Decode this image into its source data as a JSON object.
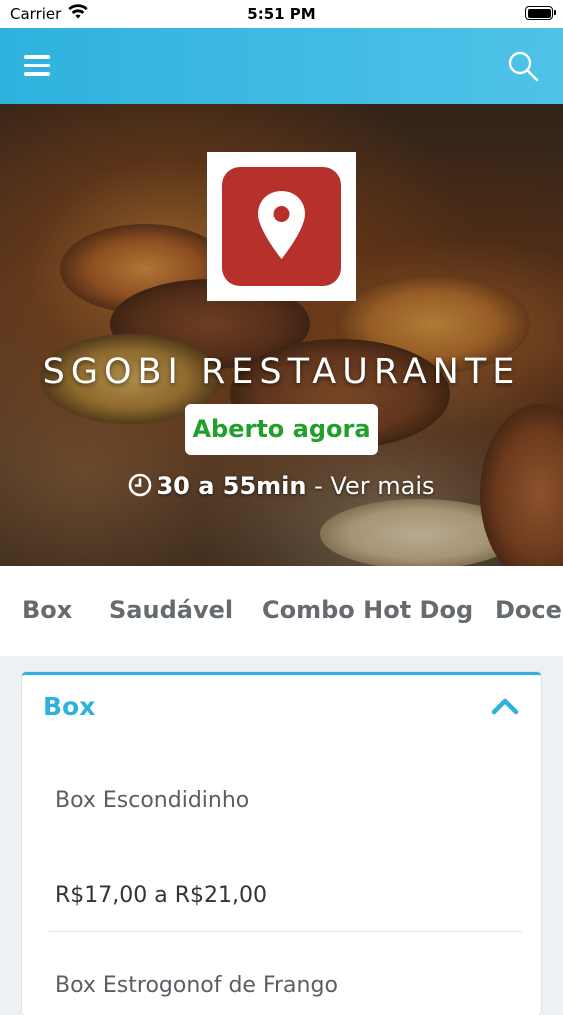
{
  "status_bar": {
    "carrier": "Carrier",
    "time": "5:51 PM"
  },
  "app_bar": {
    "menu_icon": "hamburger-menu-icon",
    "search_icon": "search-icon",
    "color": "#2eb2dd"
  },
  "restaurant": {
    "name": "SGOBI RESTAURANTE",
    "status": "Aberto agora",
    "status_color": "#20a02a",
    "delivery_time": "30 a 55min",
    "more_link": "- Ver mais",
    "logo_icon": "map-pin-icon",
    "logo_color": "#b7312c"
  },
  "categories": [
    "Box",
    "Saudável",
    "Combo Hot Dog",
    "Doces"
  ],
  "section": {
    "title": "Box",
    "items": [
      {
        "name": "Box Escondidinho",
        "price": "R$17,00 a R$21,00"
      },
      {
        "name": "Box Estrogonof de Frango"
      }
    ]
  }
}
